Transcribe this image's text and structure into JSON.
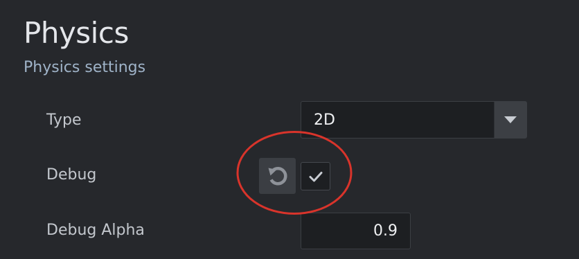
{
  "header": {
    "title": "Physics",
    "subtitle": "Physics settings"
  },
  "fields": {
    "type": {
      "label": "Type",
      "value": "2D"
    },
    "debug": {
      "label": "Debug",
      "checked": true,
      "reset_icon": "reset-icon",
      "check_icon": "checkmark-icon"
    },
    "debug_alpha": {
      "label": "Debug Alpha",
      "value": "0.9"
    }
  },
  "colors": {
    "background": "#26282c",
    "annotation": "#d9342b"
  }
}
